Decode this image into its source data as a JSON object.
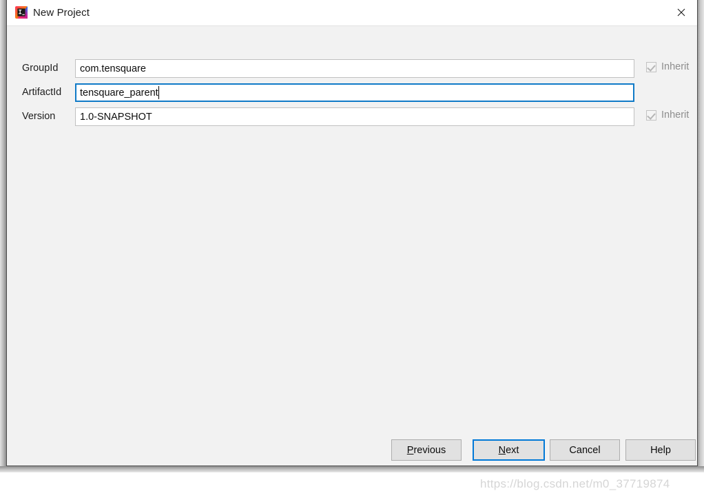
{
  "window": {
    "title": "New Project",
    "app_icon": "intellij-idea-icon",
    "close_label": "✕"
  },
  "form": {
    "fields": [
      {
        "label": "GroupId",
        "value": "com.tensquare",
        "placeholder": "",
        "focused": false,
        "inherit_label": "Inherit",
        "has_inherit": true,
        "inherit_checked": true
      },
      {
        "label": "ArtifactId",
        "value": "tensquare_parent",
        "placeholder": "",
        "focused": true,
        "inherit_label": "",
        "has_inherit": false,
        "inherit_checked": false
      },
      {
        "label": "Version",
        "value": "1.0-SNAPSHOT",
        "placeholder": "",
        "focused": false,
        "inherit_label": "Inherit",
        "has_inherit": true,
        "inherit_checked": true
      }
    ]
  },
  "buttons": {
    "previous": {
      "prefix": "",
      "mnemonic": "P",
      "suffix": "revious"
    },
    "next": {
      "prefix": "",
      "mnemonic": "N",
      "suffix": "ext"
    },
    "cancel": {
      "prefix": "Cancel",
      "mnemonic": "",
      "suffix": ""
    },
    "help": {
      "prefix": "Help",
      "mnemonic": "",
      "suffix": ""
    }
  },
  "watermark": "https://blog.csdn.net/m0_37719874",
  "colors": {
    "accent": "#0078d7",
    "focus_border": "#0f7ac7",
    "dialog_bg": "#f2f2f2",
    "titlebar_bg": "#ffffff",
    "button_bg": "#e1e1e1",
    "disabled_text": "#8d8d8d"
  }
}
